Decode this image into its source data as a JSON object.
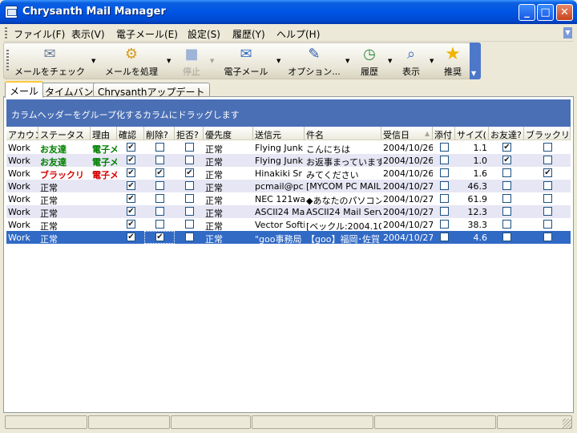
{
  "window": {
    "title": "Chrysanth Mail Manager",
    "minimize": "_",
    "maximize": "□",
    "close": "✕"
  },
  "menu": [
    "ファイル(F)",
    "表示(V)",
    "電子メール(E)",
    "設定(S)",
    "履歴(Y)",
    "ヘルプ(H)"
  ],
  "toolbar": {
    "check": "メールをチェック",
    "process": "メールを処理",
    "stop": "停止",
    "email": "電子メール",
    "options": "オプション...",
    "history": "履歴",
    "view": "表示",
    "recommend": "推奨"
  },
  "tabs": [
    "メール",
    "タイムバンク",
    "Chrysanthアップデート"
  ],
  "group_hint": "カラムヘッダーをグループ化するカラムにドラッグします",
  "columns": [
    "アカウン",
    "ステータス",
    "理由",
    "確認",
    "削除?",
    "拒否?",
    "優先度",
    "送信元",
    "件名",
    "受信日",
    "添付",
    "サイズ(",
    "お友達?",
    "ブラックリスト"
  ],
  "rows": [
    {
      "account": "Work",
      "status": "お友達",
      "status_style": "green",
      "reason": "電子メ",
      "confirm": true,
      "delete": false,
      "reject": false,
      "priority": "正常",
      "from": "Flying Junk",
      "subject": "こんにちは",
      "date": "2004/10/26",
      "attach": false,
      "size": "1.1",
      "friend": true,
      "blacklist": false
    },
    {
      "account": "Work",
      "status": "お友達",
      "status_style": "green",
      "reason": "電子メ",
      "confirm": true,
      "delete": false,
      "reject": false,
      "priority": "正常",
      "from": "Flying Junk",
      "subject": "お返事まっています",
      "date": "2004/10/26",
      "attach": false,
      "size": "1.0",
      "friend": true,
      "blacklist": false
    },
    {
      "account": "Work",
      "status": "ブラックリ",
      "status_style": "red",
      "reason": "電子メ",
      "confirm": true,
      "delete": true,
      "reject": true,
      "priority": "正常",
      "from": "Hinakiki Sr",
      "subject": "みてください",
      "date": "2004/10/26",
      "attach": false,
      "size": "1.6",
      "friend": false,
      "blacklist": true
    },
    {
      "account": "Work",
      "status": "正常",
      "status_style": "",
      "reason": "",
      "confirm": true,
      "delete": false,
      "reject": false,
      "priority": "正常",
      "from": "pcmail@pc.n",
      "subject": "[MYCOM PC MAIL",
      "date": "2004/10/27",
      "attach": false,
      "size": "46.3",
      "friend": false,
      "blacklist": false
    },
    {
      "account": "Work",
      "status": "正常",
      "status_style": "",
      "reason": "",
      "confirm": true,
      "delete": false,
      "reject": false,
      "priority": "正常",
      "from": "NEC 121war",
      "subject": "◆あなたのパソコン",
      "date": "2004/10/27",
      "attach": false,
      "size": "61.9",
      "friend": false,
      "blacklist": false
    },
    {
      "account": "Work",
      "status": "正常",
      "status_style": "",
      "reason": "",
      "confirm": true,
      "delete": false,
      "reject": false,
      "priority": "正常",
      "from": "ASCII24 Ma",
      "subject": "ASCII24 Mail Serv",
      "date": "2004/10/27",
      "attach": false,
      "size": "12.3",
      "friend": false,
      "blacklist": false
    },
    {
      "account": "Work",
      "status": "正常",
      "status_style": "",
      "reason": "",
      "confirm": true,
      "delete": false,
      "reject": false,
      "priority": "正常",
      "from": "Vector Softi",
      "subject": "[ベックル:2004.10.27",
      "date": "2004/10/27",
      "attach": false,
      "size": "38.3",
      "friend": false,
      "blacklist": false
    },
    {
      "account": "Work",
      "status": "正常",
      "status_style": "",
      "reason": "",
      "confirm": true,
      "delete": true,
      "reject": false,
      "priority": "正常",
      "from": "\"goo事務局",
      "subject": "【goo】福岡･佐賀･",
      "date": "2004/10/27",
      "attach": false,
      "size": "4.6",
      "friend": false,
      "blacklist": false
    }
  ],
  "selected_row": 7
}
